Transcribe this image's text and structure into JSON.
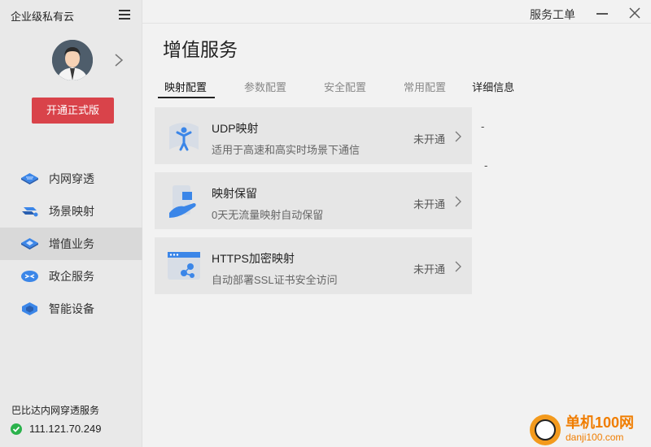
{
  "sidebar": {
    "brand": "企业级私有云",
    "upgrade_label": "开通正式版",
    "items": [
      {
        "label": "内网穿透",
        "icon": "intranet-penetration-icon"
      },
      {
        "label": "场景映射",
        "icon": "scene-mapping-icon"
      },
      {
        "label": "增值业务",
        "icon": "value-added-icon"
      },
      {
        "label": "政企服务",
        "icon": "gov-enterprise-icon"
      },
      {
        "label": "智能设备",
        "icon": "smart-device-icon"
      }
    ],
    "active_index": 2,
    "service_name": "巴比达内网穿透服务",
    "server_ip": "111.121.70.249"
  },
  "titlebar": {
    "ticket_label": "服务工单"
  },
  "main": {
    "title": "增值服务",
    "tabs": [
      {
        "label": "映射配置"
      },
      {
        "label": "参数配置"
      },
      {
        "label": "安全配置"
      },
      {
        "label": "常用配置"
      },
      {
        "label": "详细信息"
      }
    ],
    "active_tab": 0,
    "cards": [
      {
        "title": "UDP映射",
        "desc": "适用于高速和高实时场景下通信",
        "status": "未开通",
        "icon": "udp-person-icon"
      },
      {
        "title": "映射保留",
        "desc": "0天无流量映射自动保留",
        "status": "未开通",
        "icon": "hand-box-icon"
      },
      {
        "title": "HTTPS加密映射",
        "desc": "自动部署SSL证书安全访问",
        "status": "未开通",
        "icon": "https-browser-icon"
      }
    ],
    "detail_placeholder_1": "-",
    "detail_placeholder_2": "-"
  },
  "watermark": {
    "title": "单机100网",
    "subtitle": "danji100.com"
  },
  "colors": {
    "accent_red": "#d9434a",
    "icon_blue": "#3b86e8",
    "status_green": "#2bb24c"
  }
}
